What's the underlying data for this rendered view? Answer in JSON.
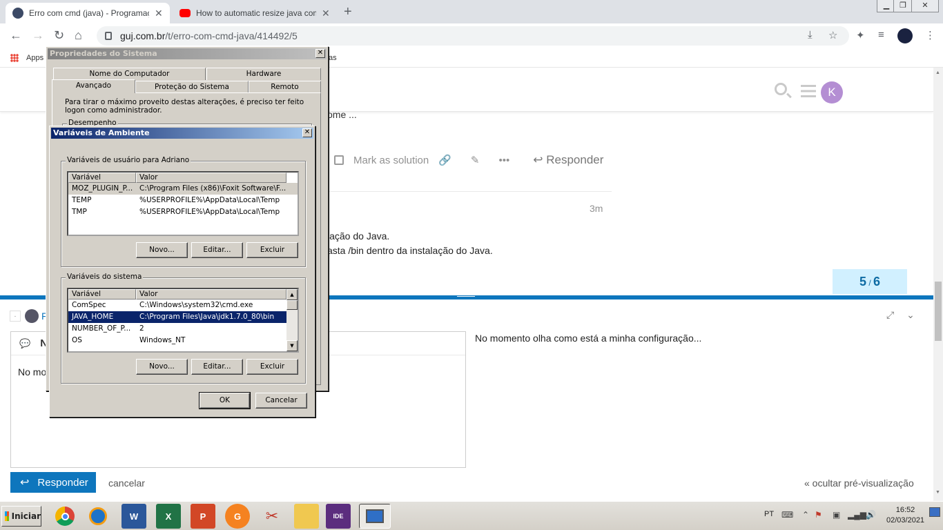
{
  "browser": {
    "tabs": [
      {
        "title": "Erro com cmd (java) - Programação",
        "favicon": "guj-icon",
        "active": true
      },
      {
        "title": "How to automatic resize java compo",
        "favicon": "youtube-icon",
        "active": false
      }
    ],
    "url_domain": "guj.com.br",
    "url_path": "/t/erro-com-cmd-java/414492/5",
    "bookmarks_apps": "Apps",
    "bookmark_fragment": "as"
  },
  "page": {
    "avatar_letter": "K",
    "excerpt": "ome ...",
    "actions": {
      "mark_solution": "Mark as solution",
      "reply": "Responder"
    },
    "timestamp": "3m",
    "post_lines": [
      "lação do Java.",
      "asta /bin dentro da instalação do Java."
    ],
    "progress": {
      "current": "5",
      "sep": " / ",
      "total": "6"
    },
    "composer": {
      "reply_letter": "F",
      "editor_heading": "N",
      "editor_text": "No mo",
      "preview_text": "No momento olha como está a minha configuração...",
      "reply_button": "Responder",
      "cancel": "cancelar",
      "hide_preview": "« ocultar pré-visualização"
    }
  },
  "sys_props": {
    "title": "Propriedades do Sistema",
    "tabs_row1": [
      "Nome do Computador",
      "Hardware"
    ],
    "tabs_row2": [
      "Avançado",
      "Proteção do Sistema",
      "Remoto"
    ],
    "admin_note": "Para tirar o máximo proveito destas alterações, é preciso ter feito logon como administrador.",
    "group_perf": "Desempenho"
  },
  "env_vars": {
    "title": "Variáveis de Ambiente",
    "user_group": "Variáveis de usuário para Adriano",
    "columns": [
      "Variável",
      "Valor"
    ],
    "user_vars": [
      {
        "name": "MOZ_PLUGIN_P...",
        "value": "C:\\Program Files (x86)\\Foxit Software\\F..."
      },
      {
        "name": "TEMP",
        "value": "%USERPROFILE%\\AppData\\Local\\Temp"
      },
      {
        "name": "TMP",
        "value": "%USERPROFILE%\\AppData\\Local\\Temp"
      }
    ],
    "system_group": "Variáveis do sistema",
    "system_vars": [
      {
        "name": "ComSpec",
        "value": "C:\\Windows\\system32\\cmd.exe"
      },
      {
        "name": "JAVA_HOME",
        "value": "C:\\Program Files\\Java\\jdk1.7.0_80\\bin"
      },
      {
        "name": "NUMBER_OF_P...",
        "value": "2"
      },
      {
        "name": "OS",
        "value": "Windows_NT"
      }
    ],
    "buttons": {
      "new": "Novo...",
      "edit": "Editar...",
      "delete": "Excluir",
      "ok": "OK",
      "cancel": "Cancelar"
    }
  },
  "taskbar": {
    "start": "Iniciar",
    "apps": [
      "chrome-icon",
      "media-player-icon",
      "word-icon",
      "excel-icon",
      "powerpoint-icon",
      "foxit-pdf-icon",
      "snipping-tool-icon",
      "file-explorer-icon",
      "java-ee-ide-icon",
      "system-properties-icon"
    ],
    "lang": "PT",
    "time": "16:52",
    "date": "02/03/2021"
  }
}
